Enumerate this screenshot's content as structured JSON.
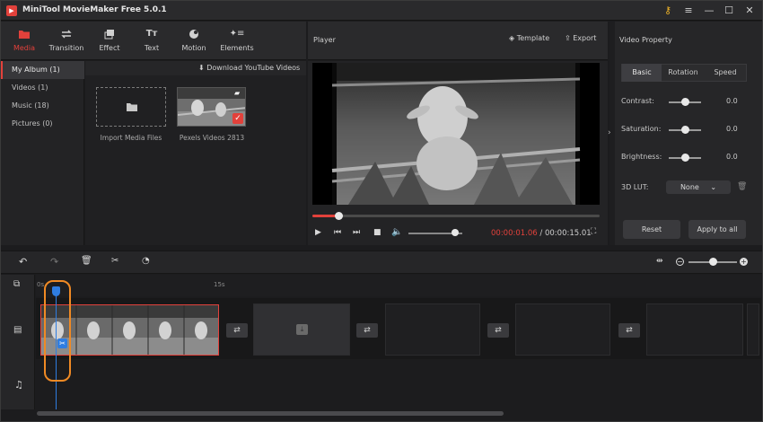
{
  "window": {
    "title": "MiniTool MovieMaker Free 5.0.1"
  },
  "tabs": [
    {
      "label": "Media",
      "icon": "folder-icon",
      "active": true
    },
    {
      "label": "Transition",
      "icon": "transition-icon"
    },
    {
      "label": "Effect",
      "icon": "effect-icon"
    },
    {
      "label": "Text",
      "icon": "text-icon"
    },
    {
      "label": "Motion",
      "icon": "motion-icon"
    },
    {
      "label": "Elements",
      "icon": "elements-icon"
    }
  ],
  "sidebar": {
    "items": [
      {
        "label": "My Album (1)",
        "active": true
      },
      {
        "label": "Videos (1)"
      },
      {
        "label": "Music (18)"
      },
      {
        "label": "Pictures (0)"
      }
    ]
  },
  "media": {
    "download_label": "Download YouTube Videos",
    "import_label": "Import Media Files",
    "clip_label": "Pexels Videos 2813"
  },
  "player": {
    "title": "Player",
    "template_label": "Template",
    "export_label": "Export",
    "current_time": "00:00:01.06",
    "separator": " / ",
    "total_time": "00:00:15.01",
    "progress": 0.09,
    "volume": 0.8
  },
  "property": {
    "title": "Video Property",
    "tabs": [
      "Basic",
      "Rotation",
      "Speed"
    ],
    "active_tab": "Basic",
    "sliders": [
      {
        "label": "Contrast:",
        "value": "0.0"
      },
      {
        "label": "Saturation:",
        "value": "0.0"
      },
      {
        "label": "Brightness:",
        "value": "0.0"
      }
    ],
    "lut_label": "3D LUT:",
    "lut_value": "None",
    "reset_label": "Reset",
    "apply_label": "Apply to all"
  },
  "timeline": {
    "ruler_start": "0s",
    "ruler_mid": "15s",
    "zoom": 0.5
  },
  "colors": {
    "accent": "#e2413b",
    "playhead": "#2f7de1",
    "highlight": "#f08a24"
  }
}
